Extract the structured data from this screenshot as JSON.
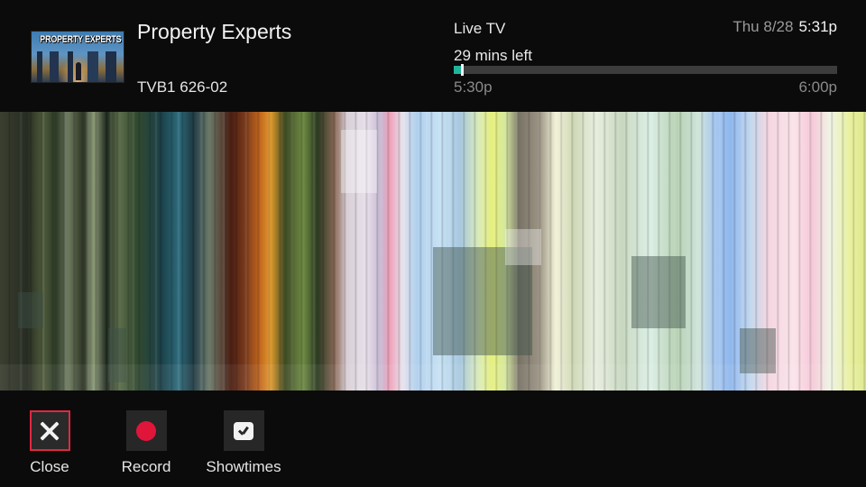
{
  "program": {
    "title": "Property Experts",
    "channel": "TVB1 626-02",
    "thumbnail_text": "PROPERTY EXPERTS"
  },
  "status": {
    "source": "Live TV",
    "time_left": "29 mins left",
    "start_time": "5:30p",
    "end_time": "6:00p",
    "progress_percent": 2,
    "progress_color": "#20b49c"
  },
  "clock": {
    "date": "Thu 8/28",
    "time": "5:31p"
  },
  "actions": [
    {
      "label": "Close",
      "icon": "close-icon",
      "selected": true
    },
    {
      "label": "Record",
      "icon": "record-icon",
      "selected": false
    },
    {
      "label": "Showtimes",
      "icon": "showtimes-icon",
      "selected": false
    }
  ],
  "colors": {
    "selected_border": "#e0283f",
    "record_red": "#e0153a"
  }
}
